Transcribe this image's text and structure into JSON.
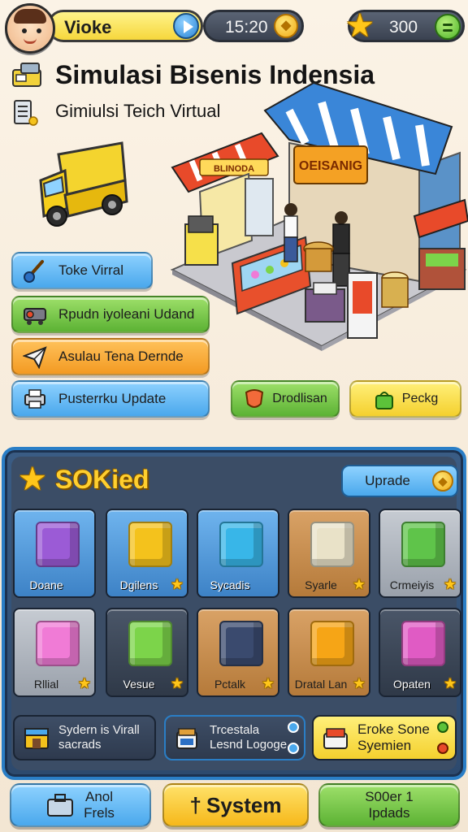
{
  "top_bar": {
    "player_name": "Vioke",
    "time": "15:20",
    "score": "300"
  },
  "header": {
    "title": "Simulasi Bisenis  Indensia",
    "subtitle": "Gimiulsi Teich Virtual"
  },
  "scene": {
    "shop_sign_1": "BLINODA",
    "shop_sign_2": "OEISANIG"
  },
  "menu": [
    {
      "label": "Toke Virral"
    },
    {
      "label": "Rpudn iyoleani Udand"
    },
    {
      "label": "Asulau Tena Dernde"
    },
    {
      "label": "Pusterrku Update"
    }
  ],
  "side_buttons": [
    {
      "label": "Drodlisan"
    },
    {
      "label": "Peckg"
    }
  ],
  "inventory": {
    "title": "SOKied",
    "upgrade_label": "Uprade",
    "items": [
      {
        "label": "Doane",
        "color": "#9b5bd6"
      },
      {
        "label": "Dgilens",
        "color": "#f4c21c"
      },
      {
        "label": "Sycadis",
        "color": "#38b6e8"
      },
      {
        "label": "Syarle",
        "color": "#e9e2c8"
      },
      {
        "label": "Crmeiyis",
        "color": "#5fc44a"
      },
      {
        "label": "Rllial",
        "color": "#f07bd6"
      },
      {
        "label": "Vesue",
        "color": "#7cd44a"
      },
      {
        "label": "Pctalk",
        "color": "#3a4a6e"
      },
      {
        "label": "Dratal Lan",
        "color": "#f6a516"
      },
      {
        "label": "Opaten",
        "color": "#e05bc4"
      }
    ],
    "bottom_cards": [
      {
        "line1": "Sydern is Virall",
        "line2": "sacrads"
      },
      {
        "line1": "Trcestala",
        "line2": "Lesnd Logoge"
      },
      {
        "line1": "Eroke Sone",
        "line2": "Syemien"
      }
    ]
  },
  "bottom_nav": [
    {
      "line1": "Anol",
      "line2": "Frels"
    },
    {
      "label": "System"
    },
    {
      "line1": "S00er 1",
      "line2": "Ipdads"
    }
  ]
}
